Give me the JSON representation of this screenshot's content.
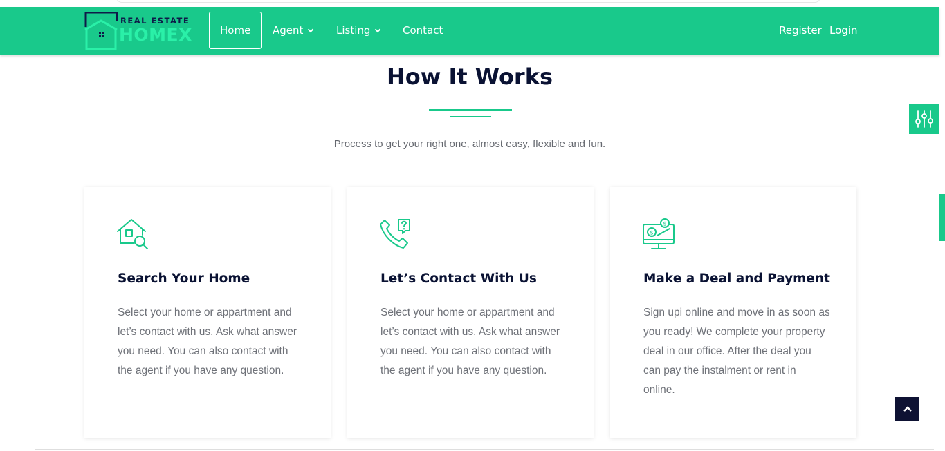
{
  "brand": {
    "small_text": "REAL ESTATE",
    "big_text": "HOMEX",
    "navy": "#0e1a48",
    "green": "#2af0a8"
  },
  "colors": {
    "accent": "#19c98b",
    "heading": "#0a1233",
    "body_text": "#6e7178",
    "back_to_top": "#0e1233"
  },
  "nav": {
    "items": [
      {
        "label": "Home",
        "active": true
      },
      {
        "label": "Agent",
        "dropdown": true
      },
      {
        "label": "Listing",
        "dropdown": true
      },
      {
        "label": "Contact"
      }
    ],
    "register_label": "Register",
    "login_label": "Login"
  },
  "section": {
    "title": "How It Works",
    "subtitle": "Process to get your right one, almost easy, flexible and fun."
  },
  "cards": [
    {
      "icon": "house-search-icon",
      "title": "Search Your Home",
      "text": "Select your home or appartment and let’s contact with us. Ask what answer you need. You can also contact with the agent if you have any question."
    },
    {
      "icon": "phone-question-icon",
      "title": "Let’s Contact With Us",
      "text": "Select your home or appartment and let’s contact with us. Ask what answer you need. You can also contact with the agent if you have any question."
    },
    {
      "icon": "monitor-payment-icon",
      "title": "Make a Deal and Payment",
      "text": "Sign upi online and move in as soon as you ready! We complete your property deal in our office. After the deal you can pay the instalment or rent in online."
    }
  ],
  "widgets": {
    "settings_icon": "sliders-icon",
    "back_to_top_icon": "chevron-up-icon"
  }
}
